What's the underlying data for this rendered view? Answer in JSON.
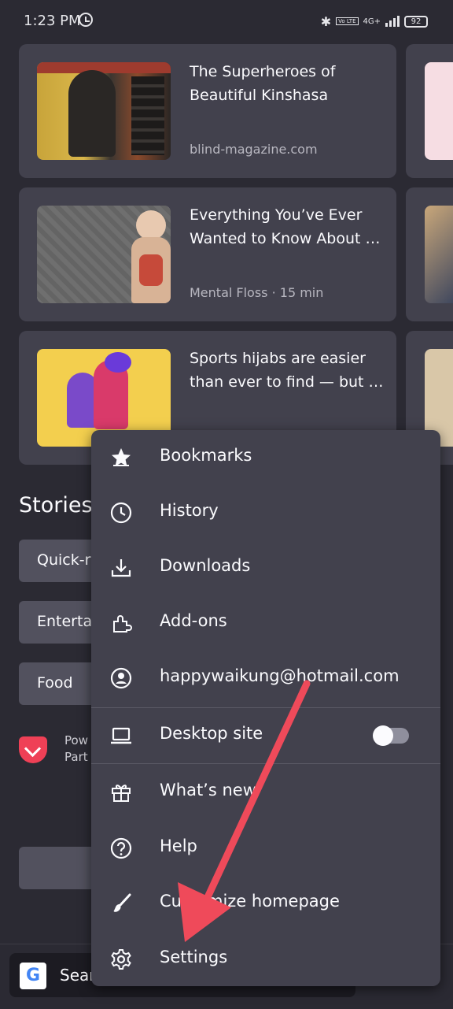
{
  "status": {
    "time": "1:23 PM",
    "bluetooth": "bluetooth-icon",
    "volte": "Vo LTE",
    "network": "4G+",
    "battery": "92"
  },
  "cards": [
    {
      "title": "The Superheroes of Beautiful Kinshasa",
      "meta": "blind-magazine.com"
    },
    {
      "title": "Everything You’ve Ever Wanted to Know About …",
      "meta": "Mental Floss · 15 min"
    },
    {
      "title": "Sports hijabs are easier than ever to find — but …",
      "meta": ""
    }
  ],
  "stories": {
    "heading": "Stories",
    "chips": [
      "Quick-r",
      "Entertai",
      "Food"
    ],
    "powered": "Pow\nPart"
  },
  "search": {
    "label": "Sear",
    "logo": "G"
  },
  "menu": {
    "items": [
      {
        "label": "Bookmarks",
        "icon": "star-icon"
      },
      {
        "label": "History",
        "icon": "clock-icon"
      },
      {
        "label": "Downloads",
        "icon": "download-icon"
      },
      {
        "label": "Add-ons",
        "icon": "puzzle-icon"
      },
      {
        "label": "happywaikung@hotmail.com",
        "icon": "account-icon"
      },
      {
        "label": "Desktop site",
        "icon": "laptop-icon",
        "toggle": false
      },
      {
        "label": "What’s new",
        "icon": "gift-icon"
      },
      {
        "label": "Help",
        "icon": "help-icon"
      },
      {
        "label": "Customize homepage",
        "icon": "brush-icon"
      },
      {
        "label": "Settings",
        "icon": "gear-icon"
      }
    ]
  },
  "colors": {
    "background": "#2b2a33",
    "card": "#42414d",
    "accent_arrow": "#ef4a5a",
    "text": "#fbfbfe"
  }
}
